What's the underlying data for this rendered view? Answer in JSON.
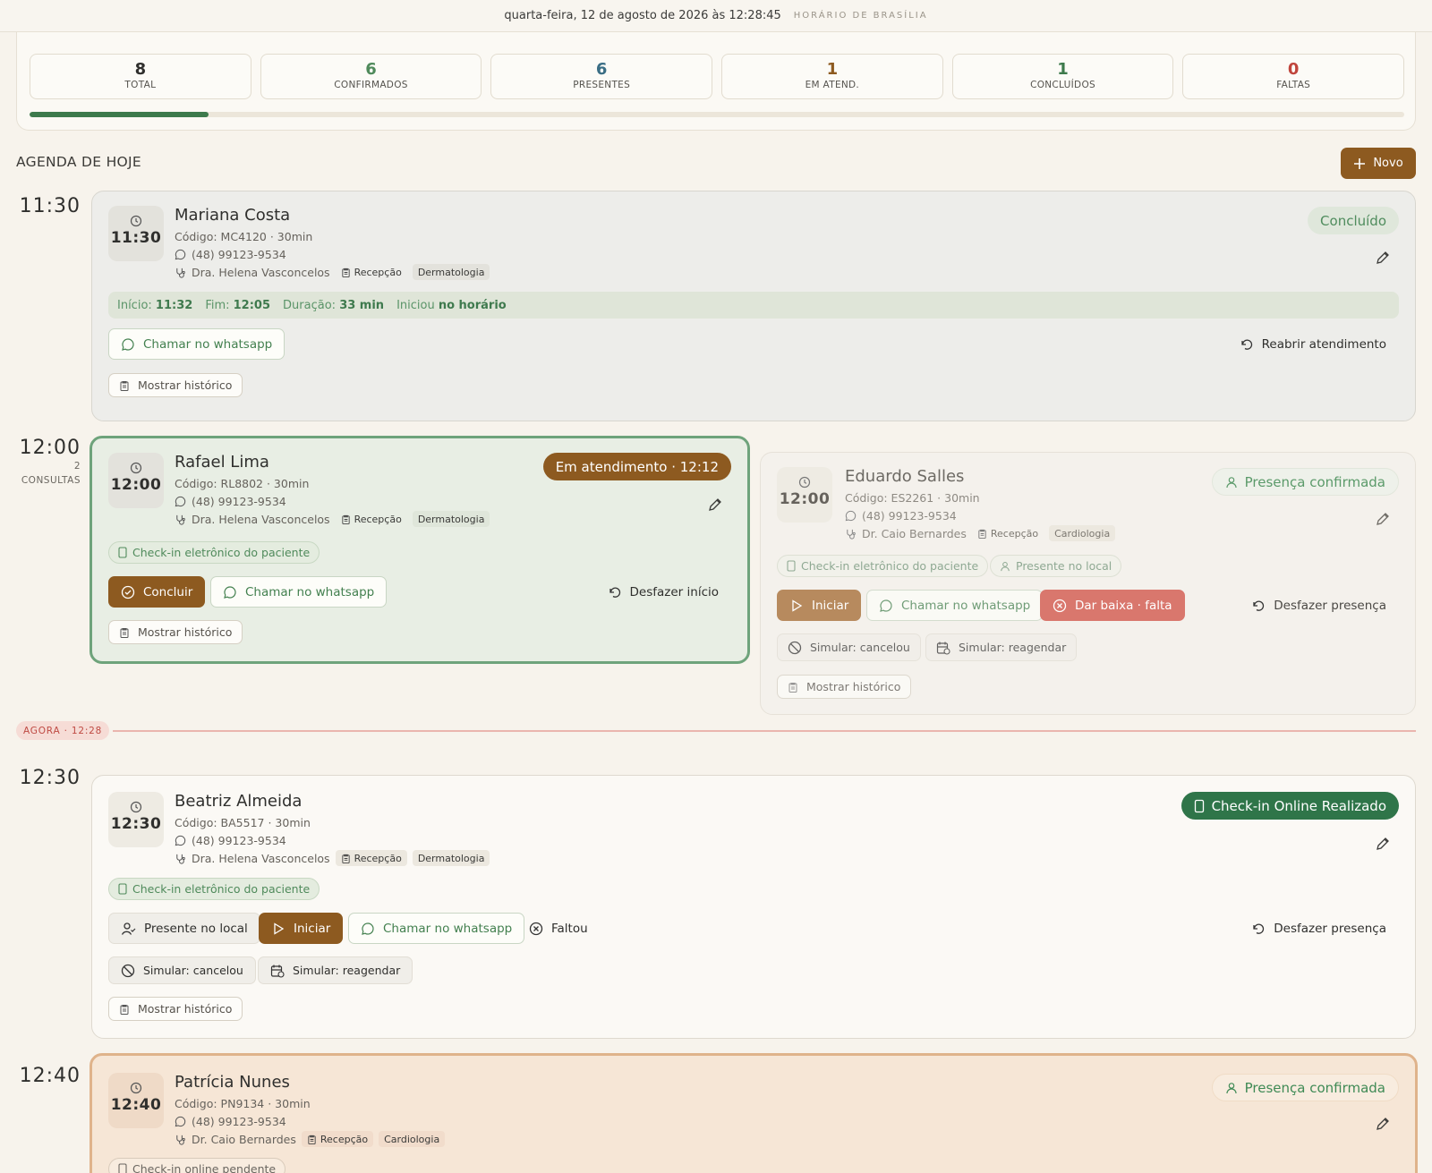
{
  "header": {
    "datetime": "quarta-feira, 12 de agosto de 2026 às 12:28:45",
    "timezone": "HORÁRIO DE BRASÍLIA"
  },
  "stats": [
    {
      "value": "8",
      "label": "TOTAL",
      "color": "#2f2f2d"
    },
    {
      "value": "6",
      "label": "CONFIRMADOS",
      "color": "#4f8a5b"
    },
    {
      "value": "6",
      "label": "PRESENTES",
      "color": "#3a6e85"
    },
    {
      "value": "1",
      "label": "EM ATEND.",
      "color": "#8d5a20"
    },
    {
      "value": "1",
      "label": "CONCLUÍDOS",
      "color": "#3d7a4c"
    },
    {
      "value": "0",
      "label": "FALTAS",
      "color": "#c0453c"
    }
  ],
  "progress": {
    "fraction": 0.13,
    "color": "#3d7a4c"
  },
  "agenda": {
    "title": "AGENDA DE HOJE",
    "new_label": "Novo"
  },
  "now": {
    "label": "AGORA · 12:28",
    "color": "#bf4a43"
  },
  "slots": {
    "s1130": {
      "time": "11:30"
    },
    "s1200": {
      "time": "12:00",
      "count": "2",
      "count_label": "CONSULTAS"
    },
    "s1230": {
      "time": "12:30"
    },
    "s1240": {
      "time": "12:40"
    }
  },
  "appointments": {
    "mariana": {
      "time": "11:30",
      "name": "Mariana Costa",
      "code": "Código: MC4120 · 30min",
      "phone": "(48) 99123-9534",
      "doctor": "Dra. Helena Vasconcelos",
      "room": "Recepção",
      "specialty": "Dermatologia",
      "status": "Concluído",
      "timing": {
        "start_label": "Início:",
        "start": "11:32",
        "end_label": "Fim:",
        "end": "12:05",
        "dur_label": "Duração:",
        "dur": "33 min",
        "note_label": "Iniciou",
        "note": "no horário"
      },
      "whatsapp": "Chamar no whatsapp",
      "reopen": "Reabrir atendimento",
      "history": "Mostrar histórico"
    },
    "rafael": {
      "time": "12:00",
      "name": "Rafael Lima",
      "code": "Código: RL8802 · 30min",
      "phone": "(48) 99123-9534",
      "doctor": "Dra. Helena Vasconcelos",
      "room": "Recepção",
      "specialty": "Dermatologia",
      "status": "Em atendimento · 12:12",
      "checkin": "Check-in eletrônico do paciente",
      "conclude": "Concluir",
      "whatsapp": "Chamar no whatsapp",
      "undo": "Desfazer início",
      "history": "Mostrar histórico"
    },
    "eduardo": {
      "time": "12:00",
      "name": "Eduardo Salles",
      "code": "Código: ES2261 · 30min",
      "phone": "(48) 99123-9534",
      "doctor": "Dr. Caio Bernardes",
      "room": "Recepção",
      "specialty": "Cardiologia",
      "status": "Presença confirmada",
      "checkin": "Check-in eletrônico do paciente",
      "present": "Presente no local",
      "start": "Iniciar",
      "whatsapp": "Chamar no whatsapp",
      "noshow": "Dar baixa · falta",
      "undo": "Desfazer presença",
      "sim_cancel": "Simular: cancelou",
      "sim_resched": "Simular: reagendar",
      "history": "Mostrar histórico"
    },
    "beatriz": {
      "time": "12:30",
      "name": "Beatriz Almeida",
      "code": "Código: BA5517 · 30min",
      "phone": "(48) 99123-9534",
      "doctor": "Dra. Helena Vasconcelos",
      "room": "Recepção",
      "specialty": "Dermatologia",
      "status": "Check-in Online Realizado",
      "checkin": "Check-in eletrônico do paciente",
      "present": "Presente no local",
      "start": "Iniciar",
      "whatsapp": "Chamar no whatsapp",
      "missed": "Faltou",
      "undo": "Desfazer presença",
      "sim_cancel": "Simular: cancelou",
      "sim_resched": "Simular: reagendar",
      "history": "Mostrar histórico"
    },
    "patricia": {
      "time": "12:40",
      "name": "Patrícia Nunes",
      "code": "Código: PN9134 · 30min",
      "phone": "(48) 99123-9534",
      "doctor": "Dr. Caio Bernardes",
      "room": "Recepção",
      "specialty": "Cardiologia",
      "status": "Presença confirmada",
      "checkin": "Check-in online pendente"
    }
  },
  "colors": {
    "brand": "#8d5a20",
    "success": "#2f7549",
    "danger": "#d9776d",
    "background": "#f7f3ec"
  }
}
